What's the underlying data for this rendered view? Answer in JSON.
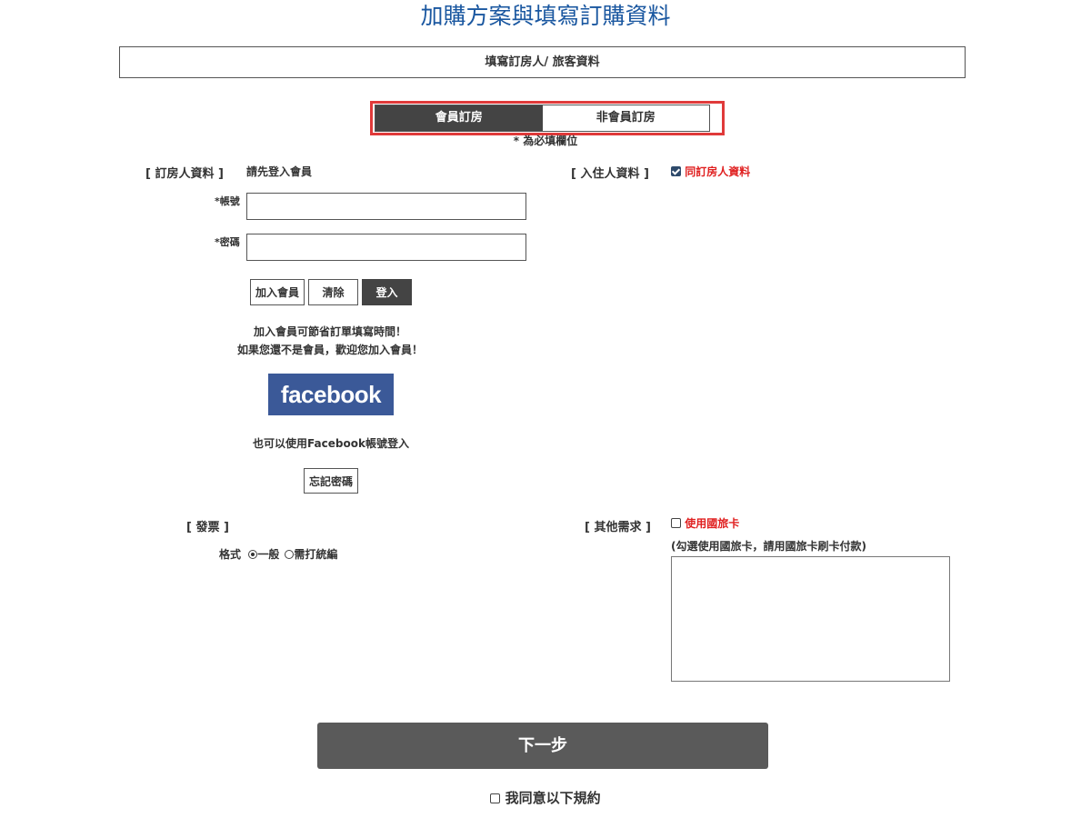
{
  "page": {
    "title": "加購方案與填寫訂購資料",
    "section_title": "填寫訂房人/ 旅客資料",
    "required_note": "* 為必填欄位"
  },
  "tabs": [
    {
      "label": "會員訂房",
      "active": true
    },
    {
      "label": "非會員訂房",
      "active": false
    }
  ],
  "booker": {
    "heading": "[ 訂房人資料 ]",
    "login_prompt": "請先登入會員",
    "account_label": "*帳號",
    "account_value": "",
    "password_label": "*密碼",
    "password_value": "",
    "join_button": "加入會員",
    "clear_button": "清除",
    "login_button": "登入",
    "promo_line1": "加入會員可節省訂單填寫時間！",
    "promo_line2": "如果您還不是會員，歡迎您加入會員！",
    "facebook_label": "facebook",
    "facebook_note": "也可以使用Facebook帳號登入",
    "forgot_button": "忘記密碼"
  },
  "guest": {
    "heading": "[ 入住人資料 ]",
    "same_as_booker_label": "同訂房人資料",
    "same_as_booker_checked": true
  },
  "invoice": {
    "heading": "[ 發票 ]",
    "format_label": "格式",
    "option_general": "一般",
    "option_tax_id": "需打統編",
    "selected": "一般"
  },
  "other": {
    "heading": "[ 其他需求 ]",
    "travel_card_label": "使用國旅卡",
    "travel_card_checked": false,
    "travel_card_note": "(勾選使用國旅卡，請用國旅卡刷卡付款)",
    "notes_value": ""
  },
  "footer": {
    "next_button": "下一步",
    "agree_label": "我同意以下規約",
    "agree_checked": false
  },
  "colors": {
    "title_blue": "#1a57a0",
    "highlight_red": "#e03a3a",
    "dark_button": "#444444",
    "facebook_blue": "#3b5998",
    "next_button": "#5a5a5a",
    "alert_red": "#e02020"
  }
}
